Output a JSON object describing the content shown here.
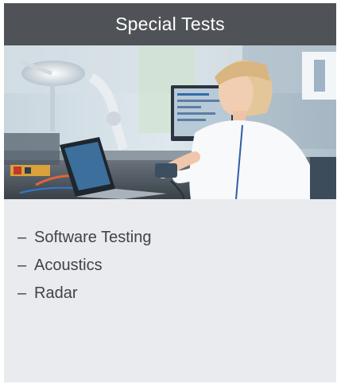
{
  "card": {
    "title": "Special Tests",
    "image_alt": "Technician working on electronics in a lab",
    "items": [
      {
        "bullet": "–",
        "label": "Software Testing"
      },
      {
        "bullet": "–",
        "label": "Acoustics"
      },
      {
        "bullet": "–",
        "label": "Radar"
      }
    ]
  },
  "colors": {
    "header_bg": "#4f5357",
    "card_bg": "#e9ebee",
    "text": "#3f4449"
  }
}
